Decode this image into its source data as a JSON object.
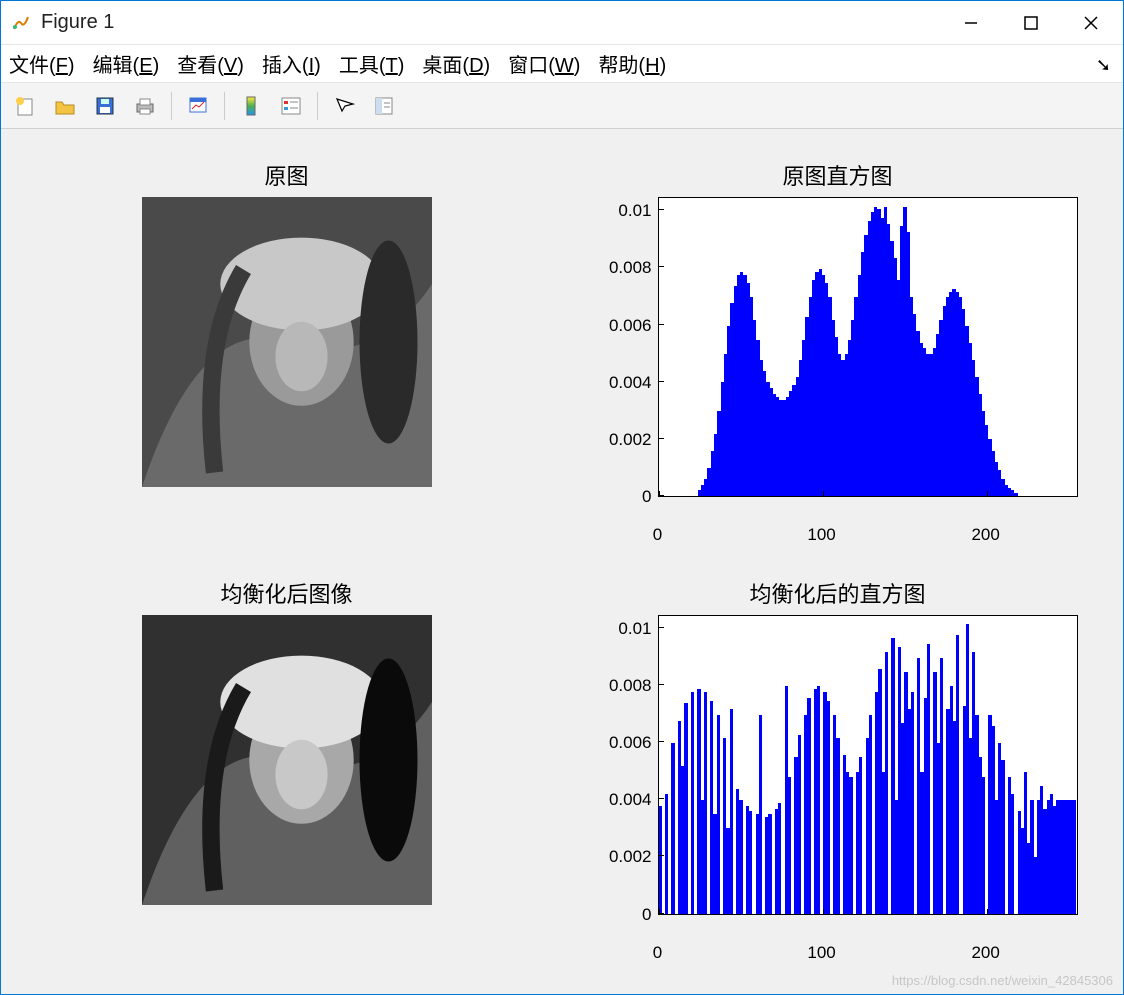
{
  "window": {
    "title": "Figure 1"
  },
  "menu": {
    "items": [
      {
        "pre": "文件(",
        "u": "F",
        "post": ")"
      },
      {
        "pre": "编辑(",
        "u": "E",
        "post": ")"
      },
      {
        "pre": "查看(",
        "u": "V",
        "post": ")"
      },
      {
        "pre": "插入(",
        "u": "I",
        "post": ")"
      },
      {
        "pre": "工具(",
        "u": "T",
        "post": ")"
      },
      {
        "pre": "桌面(",
        "u": "D",
        "post": ")"
      },
      {
        "pre": "窗口(",
        "u": "W",
        "post": ")"
      },
      {
        "pre": "帮助(",
        "u": "H",
        "post": ")"
      }
    ]
  },
  "subplots": {
    "tl_title": "原图",
    "tr_title": "原图直方图",
    "bl_title": "均衡化后图像",
    "br_title": "均衡化后的直方图"
  },
  "watermark": "https://blog.csdn.net/weixin_42845306",
  "chart_data": [
    {
      "type": "bar",
      "title": "原图直方图",
      "xlabel": "",
      "ylabel": "",
      "xlim": [
        0,
        256
      ],
      "ylim": [
        0,
        0.0105
      ],
      "xticks": [
        0,
        100,
        200
      ],
      "yticks": [
        0,
        0.002,
        0.004,
        0.006,
        0.008,
        0.01
      ],
      "x": [
        0,
        2,
        4,
        6,
        8,
        10,
        12,
        14,
        16,
        18,
        20,
        22,
        24,
        26,
        28,
        30,
        32,
        34,
        36,
        38,
        40,
        42,
        44,
        46,
        48,
        50,
        52,
        54,
        56,
        58,
        60,
        62,
        64,
        66,
        68,
        70,
        72,
        74,
        76,
        78,
        80,
        82,
        84,
        86,
        88,
        90,
        92,
        94,
        96,
        98,
        100,
        102,
        104,
        106,
        108,
        110,
        112,
        114,
        116,
        118,
        120,
        122,
        124,
        126,
        128,
        130,
        132,
        134,
        136,
        138,
        140,
        142,
        144,
        146,
        148,
        150,
        152,
        154,
        156,
        158,
        160,
        162,
        164,
        166,
        168,
        170,
        172,
        174,
        176,
        178,
        180,
        182,
        184,
        186,
        188,
        190,
        192,
        194,
        196,
        198,
        200,
        202,
        204,
        206,
        208,
        210,
        212,
        214,
        216,
        218,
        220,
        222,
        224,
        226,
        228,
        230,
        232,
        234,
        236,
        238,
        240,
        242,
        244,
        246,
        248,
        250,
        252,
        254
      ],
      "values": [
        0,
        0,
        0,
        0,
        0,
        0,
        0,
        0,
        0,
        0,
        0,
        0,
        0.0002,
        0.0004,
        0.0006,
        0.001,
        0.0016,
        0.0022,
        0.003,
        0.004,
        0.005,
        0.006,
        0.0068,
        0.0074,
        0.0078,
        0.0079,
        0.0078,
        0.0075,
        0.007,
        0.0062,
        0.0055,
        0.0048,
        0.0044,
        0.004,
        0.0038,
        0.0036,
        0.0035,
        0.0034,
        0.0034,
        0.0035,
        0.0037,
        0.0039,
        0.0042,
        0.0048,
        0.0055,
        0.0063,
        0.007,
        0.0076,
        0.0079,
        0.008,
        0.0078,
        0.0075,
        0.007,
        0.0062,
        0.0056,
        0.005,
        0.0048,
        0.005,
        0.0055,
        0.0062,
        0.007,
        0.0078,
        0.0086,
        0.0092,
        0.0097,
        0.01,
        0.0102,
        0.0101,
        0.0098,
        0.0102,
        0.0096,
        0.009,
        0.0084,
        0.0076,
        0.0095,
        0.0102,
        0.0093,
        0.007,
        0.0064,
        0.0058,
        0.0054,
        0.0052,
        0.005,
        0.005,
        0.0052,
        0.0057,
        0.0062,
        0.0067,
        0.007,
        0.0072,
        0.0073,
        0.0072,
        0.007,
        0.0066,
        0.006,
        0.0054,
        0.0048,
        0.0042,
        0.0036,
        0.003,
        0.0025,
        0.002,
        0.0016,
        0.0012,
        0.0009,
        0.0006,
        0.0004,
        0.0003,
        0.0002,
        0.0001,
        0,
        0,
        0,
        0,
        0,
        0,
        0,
        0,
        0,
        0,
        0,
        0,
        0,
        0,
        0,
        0,
        0,
        0
      ]
    },
    {
      "type": "bar",
      "title": "均衡化后的直方图",
      "xlabel": "",
      "ylabel": "",
      "xlim": [
        0,
        256
      ],
      "ylim": [
        0,
        0.0105
      ],
      "xticks": [
        0,
        100,
        200
      ],
      "yticks": [
        0,
        0.002,
        0.004,
        0.006,
        0.008,
        0.01
      ],
      "x": [
        0,
        2,
        4,
        6,
        8,
        10,
        12,
        14,
        16,
        18,
        20,
        22,
        24,
        26,
        28,
        30,
        32,
        34,
        36,
        38,
        40,
        42,
        44,
        46,
        48,
        50,
        52,
        54,
        56,
        58,
        60,
        62,
        64,
        66,
        68,
        70,
        72,
        74,
        76,
        78,
        80,
        82,
        84,
        86,
        88,
        90,
        92,
        94,
        96,
        98,
        100,
        102,
        104,
        106,
        108,
        110,
        112,
        114,
        116,
        118,
        120,
        122,
        124,
        126,
        128,
        130,
        132,
        134,
        136,
        138,
        140,
        142,
        144,
        146,
        148,
        150,
        152,
        154,
        156,
        158,
        160,
        162,
        164,
        166,
        168,
        170,
        172,
        174,
        176,
        178,
        180,
        182,
        184,
        186,
        188,
        190,
        192,
        194,
        196,
        198,
        200,
        202,
        204,
        206,
        208,
        210,
        212,
        214,
        216,
        218,
        220,
        222,
        224,
        226,
        228,
        230,
        232,
        234,
        236,
        238,
        240,
        242,
        244,
        246,
        248,
        250,
        252,
        254
      ],
      "values": [
        0.0038,
        0,
        0.0042,
        0,
        0.006,
        0,
        0.0068,
        0.0052,
        0.0074,
        0,
        0.0078,
        0,
        0.0079,
        0.004,
        0.0078,
        0,
        0.0075,
        0.0035,
        0.007,
        0,
        0.0062,
        0.003,
        0.0072,
        0,
        0.0044,
        0.004,
        0,
        0.0038,
        0.0036,
        0,
        0.0035,
        0.007,
        0,
        0.0034,
        0.0035,
        0,
        0.0037,
        0.0039,
        0,
        0.008,
        0.0048,
        0,
        0.0055,
        0.0063,
        0,
        0.007,
        0.0076,
        0,
        0.0079,
        0.008,
        0,
        0.0078,
        0.0075,
        0,
        0.007,
        0.0062,
        0,
        0.0056,
        0.005,
        0.0048,
        0,
        0.005,
        0.0055,
        0,
        0.0062,
        0.007,
        0,
        0.0078,
        0.0086,
        0.005,
        0.0092,
        0,
        0.0097,
        0.004,
        0.0094,
        0.0067,
        0.0085,
        0.0072,
        0.0078,
        0,
        0.009,
        0.005,
        0.0076,
        0.0095,
        0,
        0.0085,
        0.006,
        0.009,
        0,
        0.0072,
        0.008,
        0.0068,
        0.0098,
        0,
        0.0073,
        0.0102,
        0.0062,
        0.0092,
        0.007,
        0.0055,
        0.0048,
        0,
        0.007,
        0.0066,
        0.004,
        0.006,
        0.0054,
        0,
        0.0048,
        0.0042,
        0,
        0.0036,
        0.003,
        0.005,
        0.0025,
        0.004,
        0.002,
        0.004,
        0.0045,
        0.0037,
        0.004,
        0.0042,
        0.0038,
        0.004,
        0.004,
        0.004,
        0.004,
        0.004,
        0.004
      ]
    }
  ]
}
